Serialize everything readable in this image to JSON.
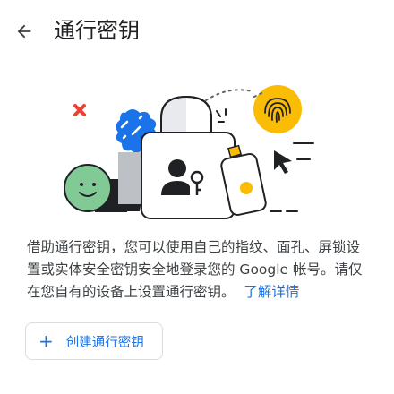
{
  "header": {
    "back_icon": "arrow-back-icon",
    "title": "通行密钥"
  },
  "illustration": {
    "icons": [
      "close-x-icon",
      "fingerprint-icon",
      "person-key-icon",
      "phone-icon",
      "cursor-icon",
      "smiley-face-icon",
      "padlock-icon"
    ],
    "colors": {
      "red": "#ea4335",
      "blue": "#1a73e8",
      "yellow": "#fbbc04",
      "green": "#81c995",
      "dark": "#202124"
    }
  },
  "description": {
    "text": "借助通行密钥，您可以使用自己的指纹、面孔、屏锁设置或实体安全密钥安全地登录您的 Google 帐号。请仅在您自有的设备上设置通行密钥。",
    "link": "了解详情"
  },
  "create_button": {
    "icon": "plus-icon",
    "label": "创建通行密钥"
  }
}
